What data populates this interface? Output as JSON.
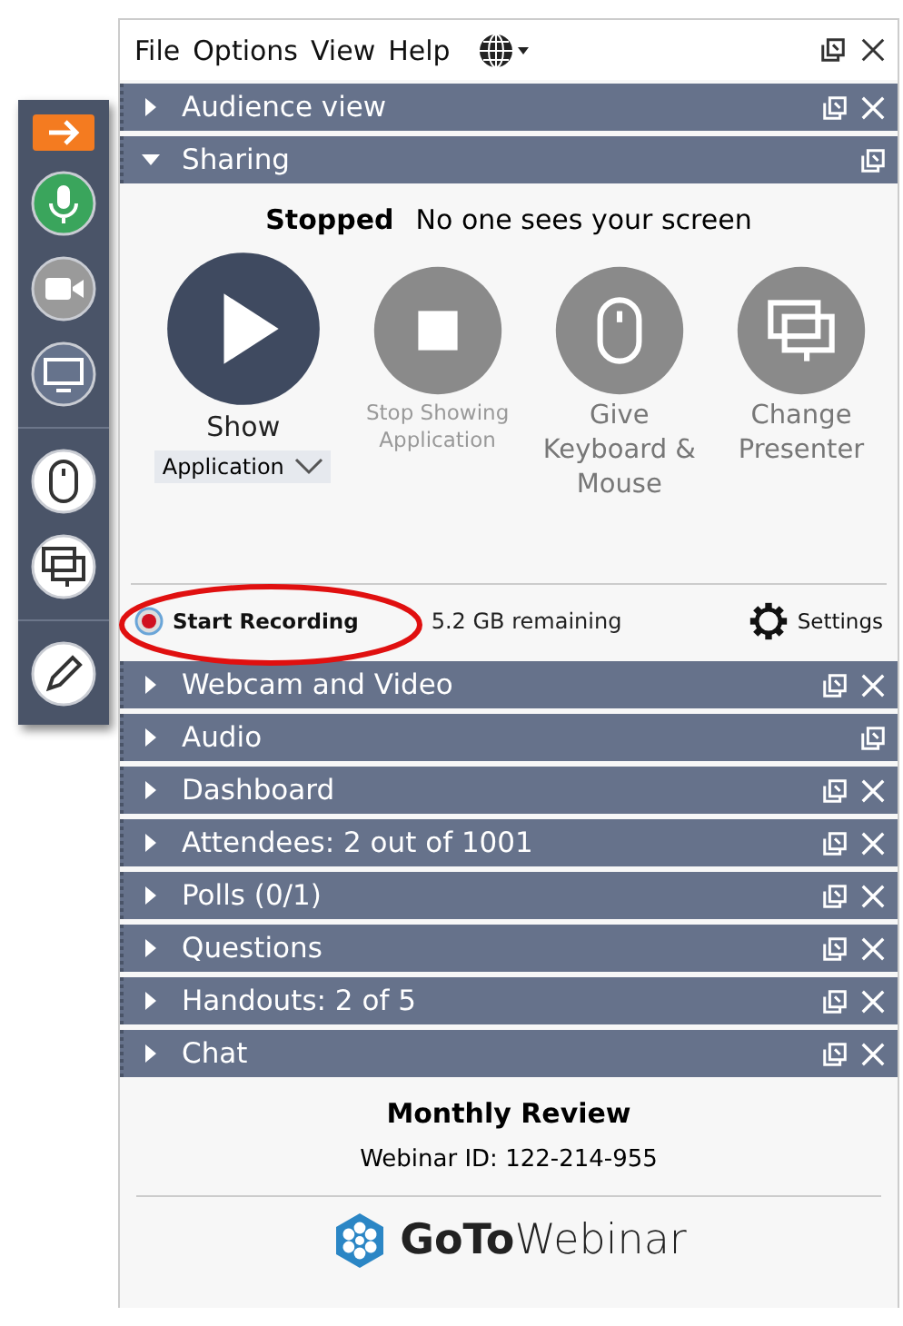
{
  "menu": [
    "File",
    "Options",
    "View",
    "Help"
  ],
  "sidebar": [
    {
      "kind": "arrow"
    },
    {
      "kind": "mic"
    },
    {
      "kind": "camera"
    },
    {
      "kind": "screen"
    },
    {
      "kind": "divider"
    },
    {
      "kind": "mouse"
    },
    {
      "kind": "screens"
    },
    {
      "kind": "divider"
    },
    {
      "kind": "pen"
    }
  ],
  "panels_top": [
    {
      "title": "Audience view",
      "expanded": false,
      "closable": true
    },
    {
      "title": "Sharing",
      "expanded": true,
      "closable": false
    }
  ],
  "sharing": {
    "status": "Stopped",
    "message": "No one sees your screen",
    "actions": [
      {
        "kind": "play",
        "label": "Show",
        "disabled": false,
        "primary": true
      },
      {
        "kind": "stop",
        "label": "Stop Showing Application",
        "disabled": true,
        "primary": false
      },
      {
        "kind": "mouse",
        "label": "Give Keyboard & Mouse",
        "disabled": false,
        "primary": false
      },
      {
        "kind": "screens",
        "label": "Change Presenter",
        "disabled": false,
        "primary": false
      }
    ],
    "show_mode": "Application",
    "record_label": "Start Recording",
    "remaining": "5.2 GB remaining",
    "settings": "Settings",
    "highlighted": true
  },
  "panels": [
    {
      "title": "Webcam and Video",
      "expanded": false,
      "closable": true
    },
    {
      "title": "Audio",
      "expanded": false,
      "closable": false
    },
    {
      "title": "Dashboard",
      "expanded": false,
      "closable": true
    },
    {
      "title": "Attendees:  2 out of 1001",
      "expanded": false,
      "closable": true
    },
    {
      "title": "Polls (0/1)",
      "expanded": false,
      "closable": true
    },
    {
      "title": "Questions",
      "expanded": false,
      "closable": true
    },
    {
      "title": "Handouts: 2 of 5",
      "expanded": false,
      "closable": true
    },
    {
      "title": "Chat",
      "expanded": false,
      "closable": true
    }
  ],
  "footer": {
    "title": "Monthly Review",
    "webinar_id": "Webinar ID: 122-214-955",
    "brand_bold": "GoTo",
    "brand_light": "Webinar"
  }
}
